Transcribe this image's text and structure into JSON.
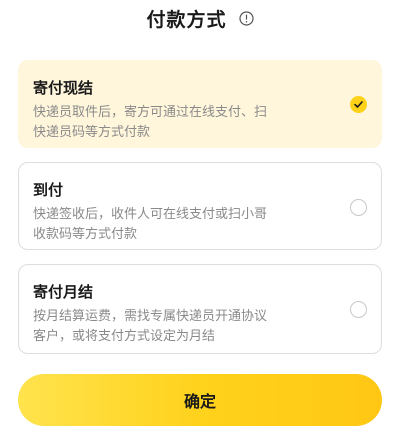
{
  "header": {
    "title": "付款方式",
    "info_icon": "info-circle-icon"
  },
  "options": [
    {
      "title": "寄付现结",
      "desc_lines": [
        "快递员取件后，寄方可通过在线支付、扫",
        "快递员码等方式付款"
      ],
      "selected": true
    },
    {
      "title": "到付",
      "desc_lines": [
        "快递签收后，收件人可在线支付或扫小哥",
        "收款码等方式付款"
      ],
      "selected": false
    },
    {
      "title": "寄付月结",
      "desc_lines": [
        "按月结算运费，需找专属快递员开通协议",
        "客户，或将支付方式设定为月结"
      ],
      "selected": false
    }
  ],
  "confirm_button": {
    "label": "确定"
  },
  "colors": {
    "accent": "#ffd21a",
    "selected_bg": "#fff6dc",
    "desc_text": "#8a8a8a"
  }
}
